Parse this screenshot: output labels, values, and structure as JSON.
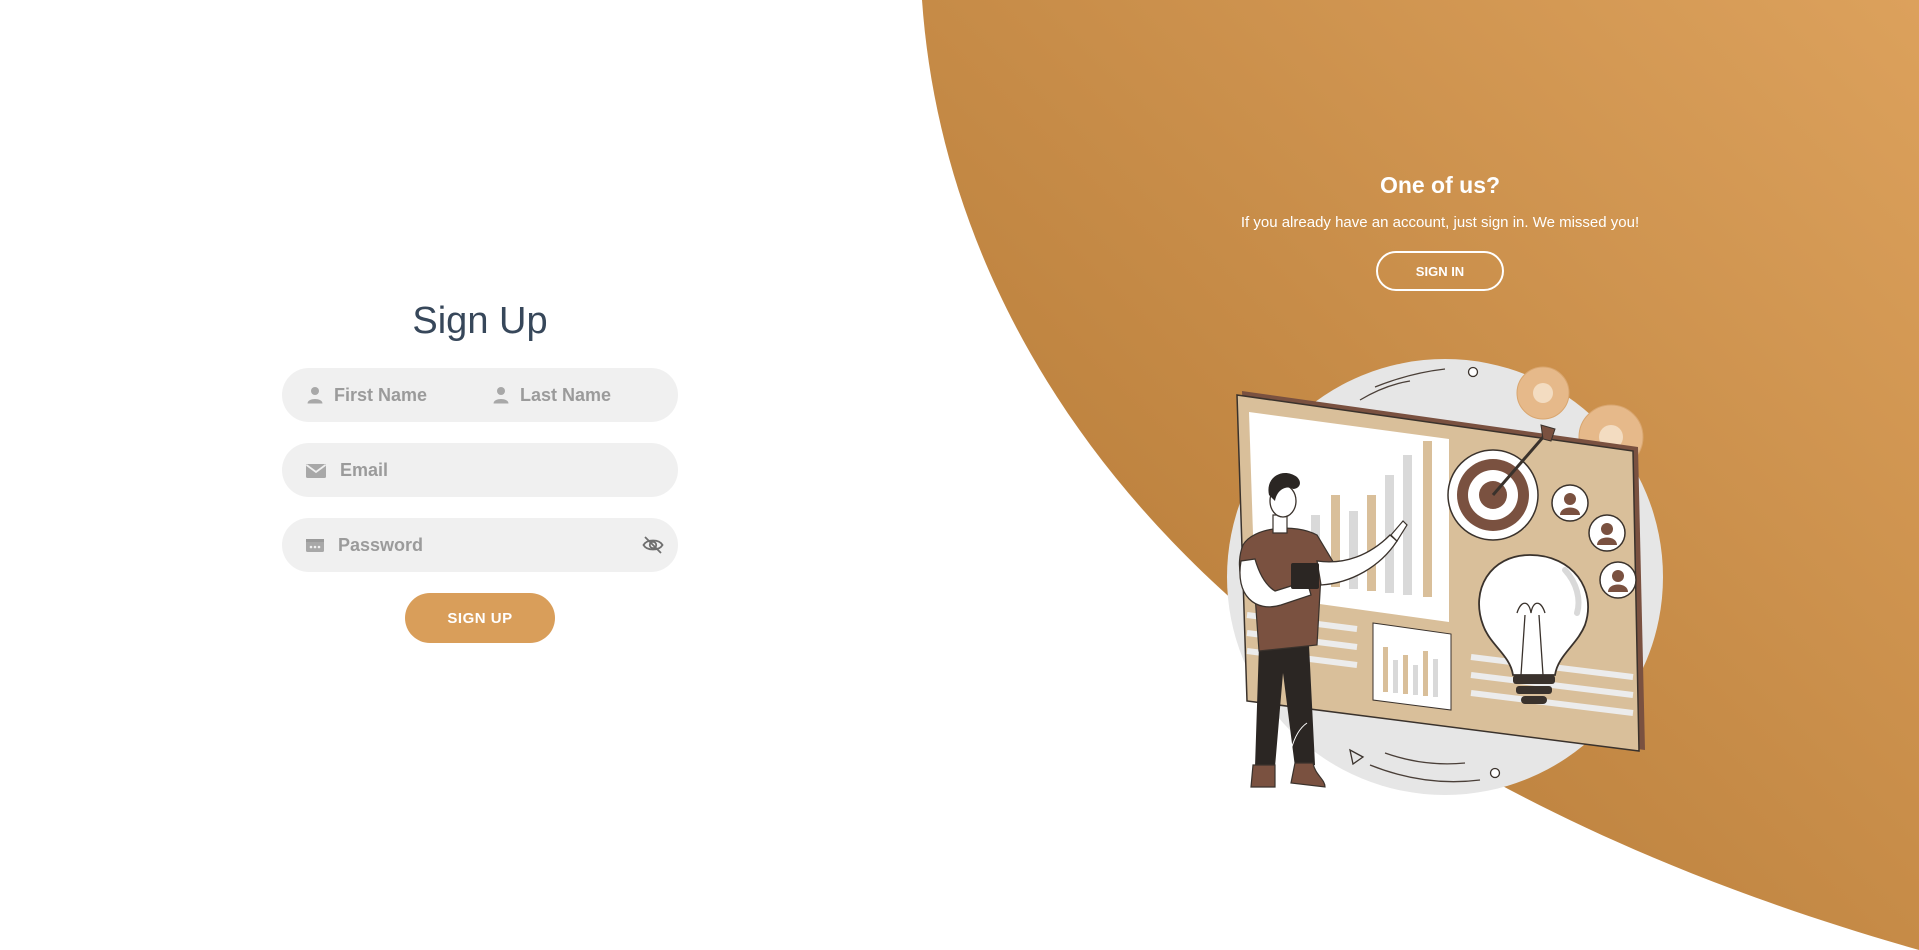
{
  "signup": {
    "title": "Sign Up",
    "first_name_placeholder": "First Name",
    "last_name_placeholder": "Last Name",
    "email_placeholder": "Email",
    "password_placeholder": "Password",
    "button_label": "SIGN UP"
  },
  "signin_panel": {
    "title": "One of us?",
    "text": "If you already have an account, just sign in. We missed you!",
    "button_label": "SIGN IN"
  },
  "icons": {
    "first_name": "user-icon",
    "last_name": "user-icon",
    "email": "envelope-icon",
    "password": "id-card-icon",
    "toggle_password": "eye-slash-icon"
  },
  "colors": {
    "accent": "#d99e5a",
    "panel_dark": "#b47c3c",
    "panel_light": "#dba05b",
    "title_text": "#37475a",
    "field_bg": "#f0f0f0"
  }
}
